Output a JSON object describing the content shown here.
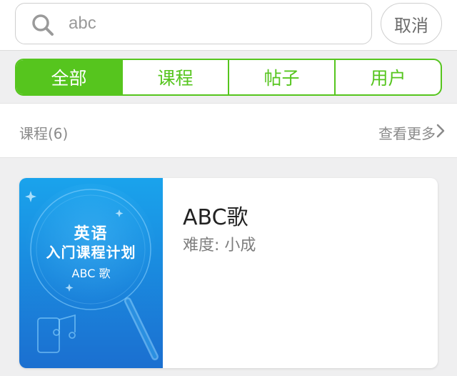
{
  "search": {
    "query": "abc",
    "cancel_label": "取消"
  },
  "tabs": [
    {
      "label": "全部",
      "active": true
    },
    {
      "label": "课程",
      "active": false
    },
    {
      "label": "帖子",
      "active": false
    },
    {
      "label": "用户",
      "active": false
    }
  ],
  "section": {
    "title": "课程(6)",
    "more_label": "查看更多"
  },
  "course": {
    "cover": {
      "line1": "英语",
      "line2": "入门课程计划",
      "line3": "ABC 歌"
    },
    "name": "ABC歌",
    "difficulty": "难度: 小成"
  },
  "colors": {
    "accent": "#56c51e",
    "cover_blue": "#1f8fe0"
  }
}
